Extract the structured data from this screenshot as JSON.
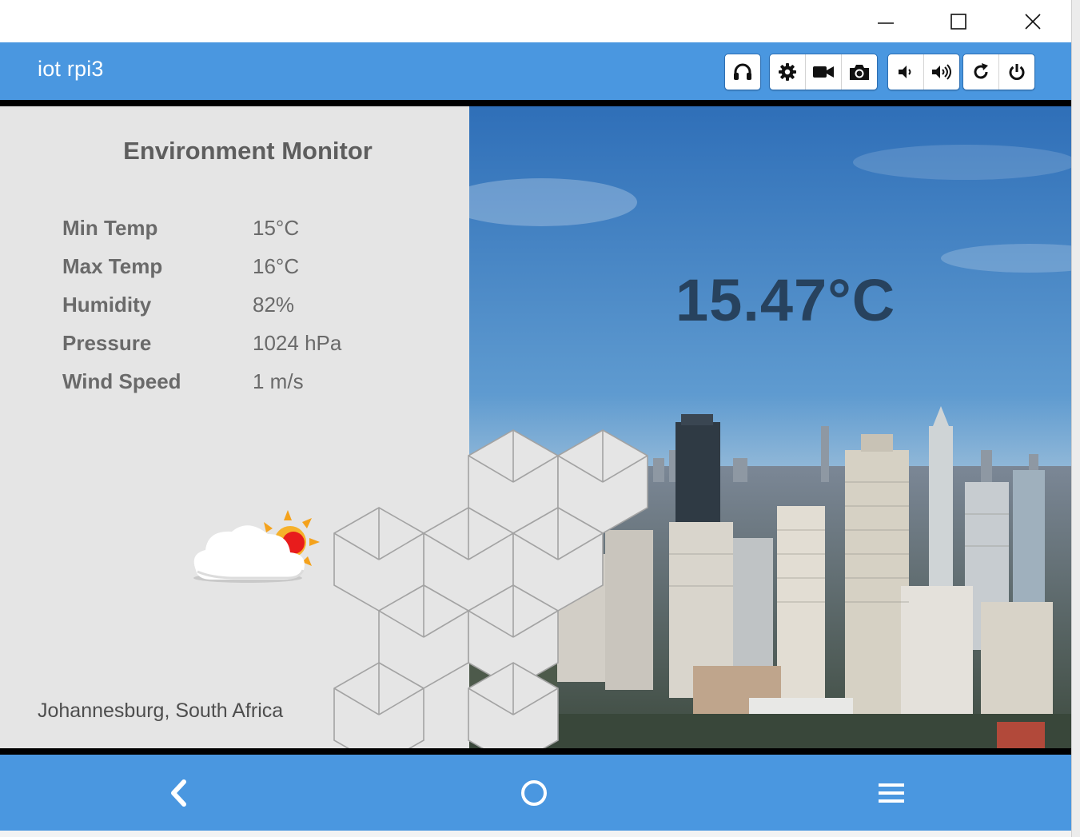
{
  "window": {
    "controls": [
      {
        "name": "minimize-icon"
      },
      {
        "name": "maximize-icon"
      },
      {
        "name": "close-icon"
      }
    ]
  },
  "appbar": {
    "title": "iot rpi3",
    "toolbar_groups": [
      [
        "headphones-icon"
      ],
      [
        "gear-icon",
        "video-camera-icon",
        "camera-icon"
      ],
      [
        "volume-down-icon",
        "volume-up-icon"
      ],
      [
        "refresh-icon",
        "power-icon"
      ]
    ]
  },
  "monitor": {
    "title": "Environment Monitor",
    "readings": [
      {
        "label": "Min Temp",
        "value": "15°C"
      },
      {
        "label": "Max Temp",
        "value": "16°C"
      },
      {
        "label": "Humidity",
        "value": "82%"
      },
      {
        "label": "Pressure",
        "value": "1024 hPa"
      },
      {
        "label": "Wind Speed",
        "value": "1 m/s"
      }
    ],
    "location": "Johannesburg, South Africa",
    "current_temp": "15.47°C",
    "weather_icon": "partly-cloudy-icon"
  },
  "navbar": {
    "items": [
      "back-icon",
      "home-icon",
      "menu-icon"
    ]
  },
  "colors": {
    "accent": "#4a97e0",
    "panel": "#e5e5e5",
    "temp_text": "#27425e"
  }
}
